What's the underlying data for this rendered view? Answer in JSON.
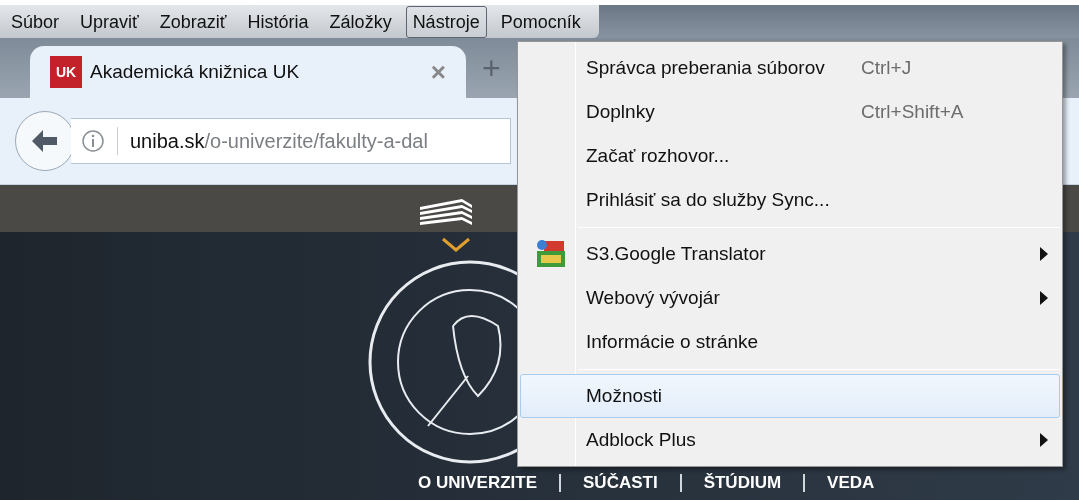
{
  "menubar": [
    {
      "label": "Súbor",
      "selected": false
    },
    {
      "label": "Upraviť",
      "selected": false
    },
    {
      "label": "Zobraziť",
      "selected": false
    },
    {
      "label": "História",
      "selected": false
    },
    {
      "label": "Záložky",
      "selected": false
    },
    {
      "label": "Nástroje",
      "selected": true
    },
    {
      "label": "Pomocník",
      "selected": false
    }
  ],
  "tabs": [
    {
      "favicon_text": "UK",
      "title": "Akademická knižnica UK",
      "close": "×",
      "selected": true
    }
  ],
  "new_tab": "+",
  "address_bar": {
    "domain": "uniba.sk",
    "path": "/o-univerzite/fakulty-a-dal"
  },
  "site_nav": [
    {
      "label": "O UNIVERZITE"
    },
    {
      "label": "SÚČASTI"
    },
    {
      "label": "ŠTÚDIUM"
    },
    {
      "label": "VEDA"
    }
  ],
  "tools_menu": [
    {
      "kind": "item",
      "label": "Správca preberania súborov",
      "shortcut": "Ctrl+J",
      "submenu": false,
      "has_icon": false,
      "selected": false
    },
    {
      "kind": "item",
      "label": "Doplnky",
      "shortcut": "Ctrl+Shift+A",
      "submenu": false,
      "has_icon": false,
      "selected": false
    },
    {
      "kind": "item",
      "label": "Začať rozhovor...",
      "submenu": false,
      "has_icon": false,
      "selected": false
    },
    {
      "kind": "item",
      "label": "Prihlásiť sa do služby Sync...",
      "submenu": false,
      "has_icon": false,
      "selected": false
    },
    {
      "kind": "separator"
    },
    {
      "kind": "item",
      "label": "S3.Google Translator",
      "submenu": true,
      "has_icon": true,
      "selected": false
    },
    {
      "kind": "item",
      "label": "Webový vývojár",
      "submenu": true,
      "has_icon": false,
      "selected": false
    },
    {
      "kind": "item",
      "label": "Informácie o stránke",
      "submenu": false,
      "has_icon": false,
      "selected": false
    },
    {
      "kind": "separator"
    },
    {
      "kind": "item",
      "label": "Možnosti",
      "submenu": false,
      "has_icon": false,
      "selected": true
    },
    {
      "kind": "item",
      "label": "Adblock Plus",
      "submenu": true,
      "has_icon": false,
      "selected": false
    }
  ]
}
